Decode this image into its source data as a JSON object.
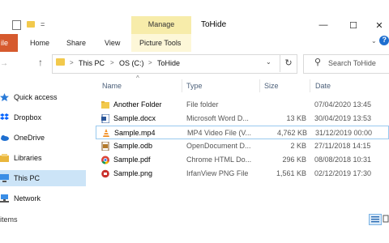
{
  "titlebar": {
    "context_tab": "Manage",
    "title": "ToHide",
    "qa_customize": "=",
    "controls": {
      "minimize": "—",
      "maximize": "☐",
      "close": "✕"
    }
  },
  "ribbon": {
    "file": "ile",
    "tabs": [
      "Home",
      "Share",
      "View",
      "Picture Tools"
    ],
    "caret": "⌄",
    "help": "?"
  },
  "address": {
    "back": "→",
    "up": "↑",
    "crumbs": [
      "This PC",
      "OS (C:)",
      "ToHide"
    ],
    "sep": ">",
    "dropdown": "⌄",
    "refresh": "↻",
    "search_placeholder": "Search ToHide",
    "search_glyph": "⚲"
  },
  "nav": {
    "items": [
      {
        "label": "Quick access"
      },
      {
        "label": "Dropbox"
      },
      {
        "label": "OneDrive"
      },
      {
        "label": "Libraries"
      },
      {
        "label": "This PC"
      },
      {
        "label": "Network"
      }
    ]
  },
  "columns": {
    "name": "Name",
    "type": "Type",
    "size": "Size",
    "date": "Date",
    "sort_glyph": "^"
  },
  "files": [
    {
      "name": "Another Folder",
      "type": "File folder",
      "size": "",
      "date": "07/04/2020 13:45"
    },
    {
      "name": "Sample.docx",
      "type": "Microsoft Word D...",
      "size": "13 KB",
      "date": "30/04/2019 13:53"
    },
    {
      "name": "Sample.mp4",
      "type": "MP4 Video File (V...",
      "size": "4,762 KB",
      "date": "31/12/2019 00:00"
    },
    {
      "name": "Sample.odb",
      "type": "OpenDocument D...",
      "size": "2 KB",
      "date": "27/11/2018 14:15"
    },
    {
      "name": "Sample.pdf",
      "type": "Chrome HTML Do...",
      "size": "296 KB",
      "date": "08/08/2018 10:31"
    },
    {
      "name": "Sample.png",
      "type": "IrfanView PNG File",
      "size": "1,561 KB",
      "date": "02/12/2019 17:30"
    }
  ],
  "status": {
    "count": "items"
  },
  "colors": {
    "file_tab": "#d65a2e",
    "manage": "#f7ecaa",
    "selected_nav": "#cce4f7",
    "folder": "#f2c94c"
  }
}
